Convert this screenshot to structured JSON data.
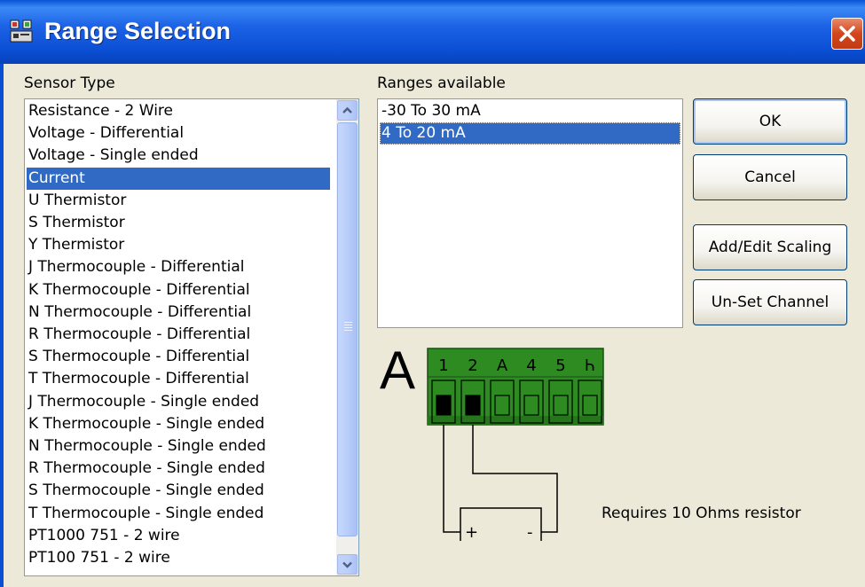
{
  "window": {
    "title": "Range Selection"
  },
  "sensor_type": {
    "label": "Sensor Type",
    "selected_index": 3,
    "items": [
      "Resistance - 2 Wire",
      "Voltage - Differential",
      "Voltage - Single ended",
      "Current",
      "U  Thermistor",
      "S  Thermistor",
      "Y  Thermistor",
      "J Thermocouple - Differential",
      "K Thermocouple - Differential",
      "N Thermocouple - Differential",
      "R Thermocouple - Differential",
      "S Thermocouple - Differential",
      "T Thermocouple - Differential",
      "J Thermocouple - Single ended",
      "K Thermocouple - Single ended",
      "N Thermocouple - Single ended",
      "R Thermocouple - Single ended",
      "S Thermocouple - Single ended",
      "T Thermocouple - Single ended",
      "PT1000 751 - 2 wire",
      "PT100 751 - 2 wire"
    ]
  },
  "ranges": {
    "label": "Ranges available",
    "selected_index": 1,
    "items": [
      "-30 To 30 mA",
      "4 To 20 mA"
    ]
  },
  "buttons": {
    "ok": "OK",
    "cancel": "Cancel",
    "add_edit_scaling": "Add/Edit Scaling",
    "unset_channel": "Un-Set Channel"
  },
  "diagram": {
    "channel_letter": "A",
    "terminals": [
      "1",
      "2",
      "A",
      "4",
      "5",
      "Ꮒ"
    ],
    "polarity_plus": "+",
    "polarity_minus": "-",
    "note": "Requires 10 Ohms resistor",
    "colors": {
      "connector_green": "#2e8b22",
      "background": "#ece9d8"
    }
  }
}
